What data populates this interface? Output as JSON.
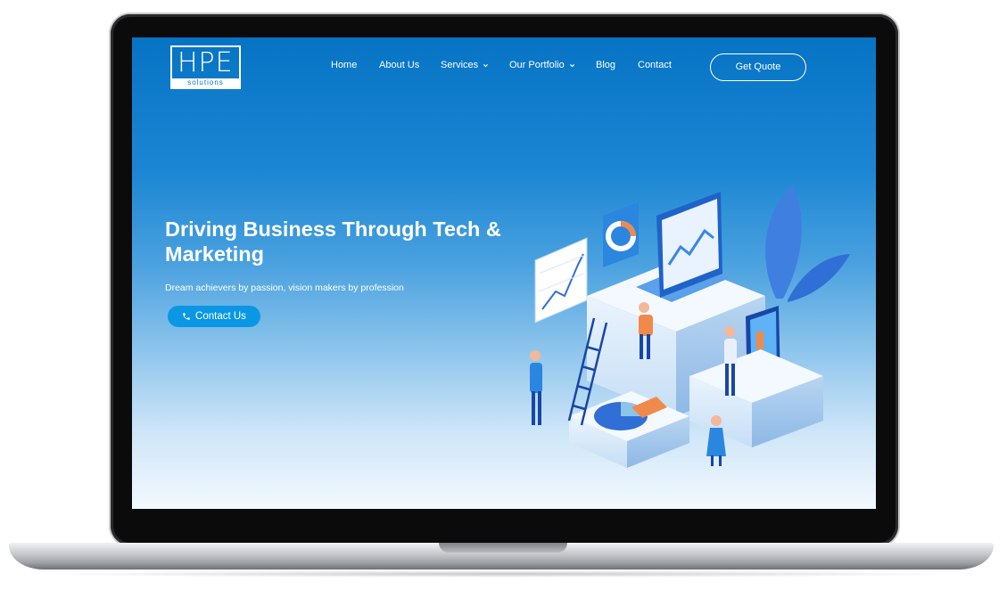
{
  "brand": {
    "logo_text": "HPE",
    "logo_sub": "solutions"
  },
  "nav": {
    "items": [
      {
        "label": "Home",
        "has_dropdown": false
      },
      {
        "label": "About Us",
        "has_dropdown": false
      },
      {
        "label": "Services",
        "has_dropdown": true
      },
      {
        "label": "Our Portfolio",
        "has_dropdown": true
      },
      {
        "label": "Blog",
        "has_dropdown": false
      },
      {
        "label": "Contact",
        "has_dropdown": false
      }
    ],
    "cta_label": "Get Quote"
  },
  "hero": {
    "title": "Driving Business Through Tech & Marketing",
    "subtitle": "Dream achievers by passion, vision makers by profession",
    "button_label": "Contact Us",
    "button_icon": "phone-icon"
  },
  "colors": {
    "brand_blue": "#0673c4",
    "button_blue": "#0a97e3",
    "accent_orange": "#f08a4b"
  }
}
